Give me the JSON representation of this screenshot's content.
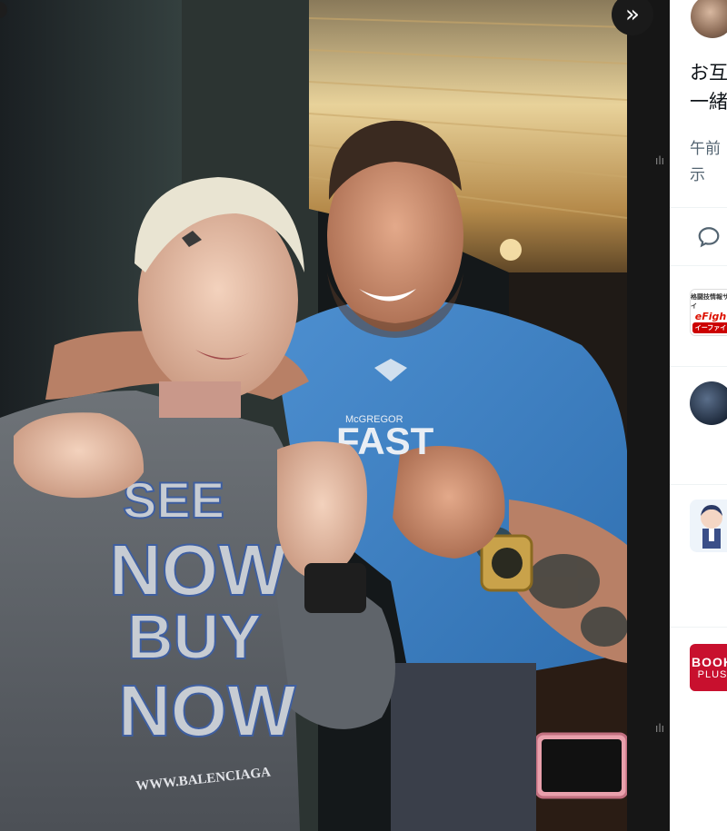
{
  "viewer": {
    "expand_icon": "chevron-double-right-icon",
    "expand_glyph": "»"
  },
  "photo": {
    "shirt_text_left": [
      "SEE",
      "NOW",
      "BUY",
      "NOW"
    ],
    "sweatshirt_url": "WWW.BALENCIAGA",
    "shirt_text_right_small": "McGREGOR",
    "shirt_text_right": "FAST"
  },
  "panel": {
    "tweet_lines": [
      "お互",
      "一緒"
    ],
    "meta_lines": [
      "午前",
      "示"
    ],
    "reply_icon": "reply-bubble-icon",
    "efight": {
      "line1": "格闘技情報サイ",
      "line2": "eFigh",
      "line3": "イーファイ"
    },
    "book": {
      "line1": "BOOK",
      "line2": "PLUS"
    }
  }
}
